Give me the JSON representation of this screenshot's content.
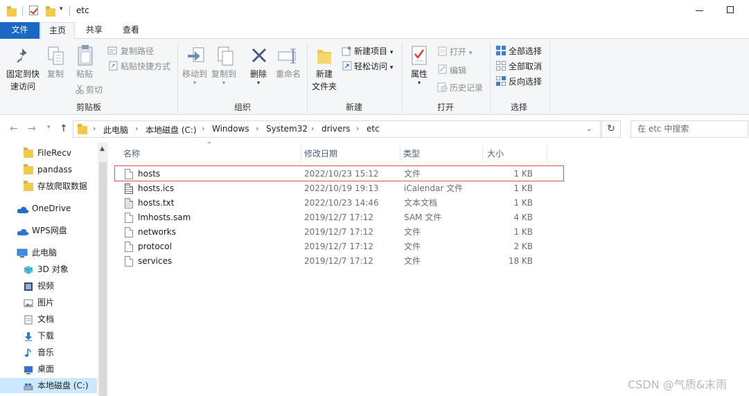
{
  "window": {
    "title": "etc"
  },
  "ribbon_tabs": [
    {
      "label": "文件"
    },
    {
      "label": "主页"
    },
    {
      "label": "共享"
    },
    {
      "label": "查看"
    }
  ],
  "ribbon": {
    "clipboard": {
      "group_label": "剪贴板",
      "pin_quick_access": "固定到快速访问",
      "pin_line1": "固定到快",
      "pin_line2": "速访问",
      "copy": "复制",
      "paste": "粘贴",
      "copy_path": "复制路径",
      "paste_shortcut": "粘贴快捷方式",
      "cut": "剪切"
    },
    "organize": {
      "group_label": "组织",
      "move_to": "移动到",
      "copy_to": "复制到",
      "delete": "删除",
      "rename": "重命名"
    },
    "new": {
      "group_label": "新建",
      "new_folder_line1": "新建",
      "new_folder_line2": "文件夹",
      "new_item": "新建项目",
      "easy_access": "轻松访问"
    },
    "open": {
      "group_label": "打开",
      "properties": "属性",
      "open": "打开",
      "edit": "编辑",
      "history": "历史记录"
    },
    "select": {
      "group_label": "选择",
      "select_all": "全部选择",
      "select_none": "全部取消",
      "invert": "反向选择"
    }
  },
  "address": {
    "crumbs": [
      "此电脑",
      "本地磁盘 (C:)",
      "Windows",
      "System32",
      "drivers",
      "etc"
    ],
    "search_placeholder": "在 etc 中搜索"
  },
  "nav_pane": {
    "items": [
      {
        "label": "FileRecv",
        "icon": "folder-icon"
      },
      {
        "label": "pandass",
        "icon": "folder-icon"
      },
      {
        "label": "存放爬取数据",
        "icon": "folder-icon"
      },
      {
        "label": "OneDrive",
        "icon": "cloud-icon"
      },
      {
        "label": "WPS网盘",
        "icon": "cloud-icon"
      },
      {
        "label": "此电脑",
        "icon": "computer-icon"
      },
      {
        "label": "3D 对象",
        "icon": "cube-icon"
      },
      {
        "label": "视频",
        "icon": "video-icon"
      },
      {
        "label": "图片",
        "icon": "picture-icon"
      },
      {
        "label": "文档",
        "icon": "document-icon"
      },
      {
        "label": "下载",
        "icon": "download-icon"
      },
      {
        "label": "音乐",
        "icon": "music-icon"
      },
      {
        "label": "桌面",
        "icon": "desktop-icon"
      },
      {
        "label": "本地磁盘 (C:)",
        "icon": "drive-icon"
      }
    ]
  },
  "file_list": {
    "columns": [
      "名称",
      "修改日期",
      "类型",
      "大小"
    ],
    "rows": [
      {
        "name": "hosts",
        "date": "2022/10/23 15:12",
        "type": "文件",
        "size": "1 KB",
        "icon": "file-icon"
      },
      {
        "name": "hosts.ics",
        "date": "2022/10/19 19:13",
        "type": "iCalendar 文件",
        "size": "1 KB",
        "icon": "calendar-file-icon"
      },
      {
        "name": "hosts.txt",
        "date": "2022/10/23 14:46",
        "type": "文本文档",
        "size": "1 KB",
        "icon": "text-file-icon"
      },
      {
        "name": "lmhosts.sam",
        "date": "2019/12/7 17:12",
        "type": "SAM 文件",
        "size": "4 KB",
        "icon": "file-icon"
      },
      {
        "name": "networks",
        "date": "2019/12/7 17:12",
        "type": "文件",
        "size": "1 KB",
        "icon": "file-icon"
      },
      {
        "name": "protocol",
        "date": "2019/12/7 17:12",
        "type": "文件",
        "size": "2 KB",
        "icon": "file-icon"
      },
      {
        "name": "services",
        "date": "2019/12/7 17:12",
        "type": "文件",
        "size": "18 KB",
        "icon": "file-icon"
      }
    ]
  },
  "watermark": "CSDN @气质&末雨",
  "colors": {
    "file_tab": "#1a68c4",
    "highlight": "#d9534f",
    "selected": "#cce8ff",
    "folder": "#f2c94c"
  }
}
